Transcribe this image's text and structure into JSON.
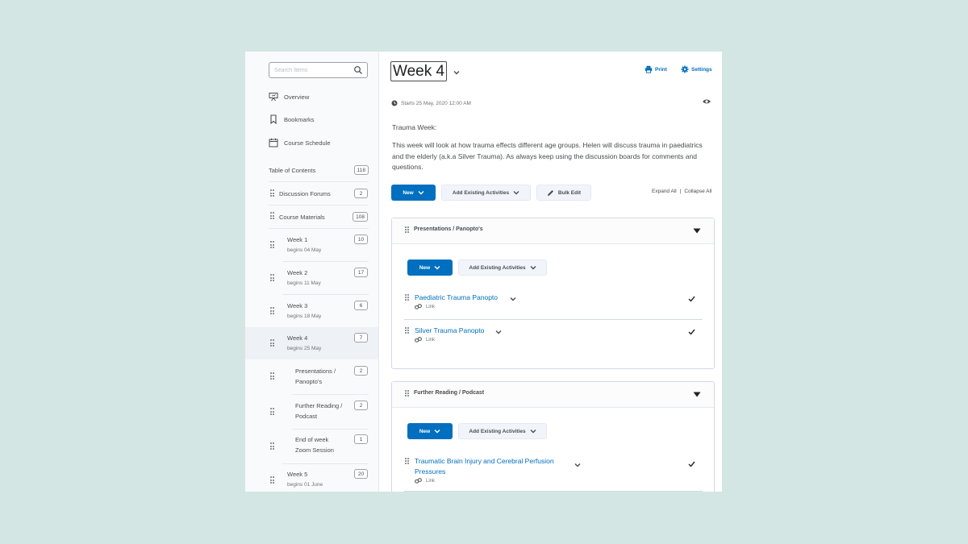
{
  "sidebar": {
    "search_placeholder": "Search Items",
    "links": [
      {
        "label": "Overview",
        "icon": "presentation-icon"
      },
      {
        "label": "Bookmarks",
        "icon": "bookmark-icon"
      },
      {
        "label": "Course Schedule",
        "icon": "calendar-icon"
      }
    ],
    "toc": {
      "label": "Table of Contents",
      "count": "118"
    },
    "items": [
      {
        "title": "Discussion Forums",
        "count": "2"
      },
      {
        "title": "Course Materials",
        "count": "108"
      },
      {
        "title": "Week 1",
        "sub": "begins 04 May",
        "count": "10"
      },
      {
        "title": "Week 2",
        "sub": "begins 11 May",
        "count": "17"
      },
      {
        "title": "Week 3",
        "sub": "begins 18 May",
        "count": "6"
      },
      {
        "title": "Week 4",
        "sub": "begins 25 May",
        "count": "7"
      },
      {
        "title": "Presentations /",
        "sub": "Panopto's",
        "count": "2"
      },
      {
        "title": "Further Reading /",
        "sub": "Podcast",
        "count": "2"
      },
      {
        "title": "End of week",
        "sub": "Zoom Session",
        "count": "1"
      },
      {
        "title": "Week 5",
        "sub": "begins 01 June",
        "count": "20"
      }
    ]
  },
  "header": {
    "title": "Week 4",
    "print_label": "Print",
    "settings_label": "Settings",
    "starts": "Starts 25 May, 2020 12:00 AM"
  },
  "description": {
    "heading": "Trauma Week:",
    "body": "This week will look at how trauma effects different age groups. Helen will discuss trauma in paediatrics and the elderly (a.k.a Silver Trauma). As always keep using the discussion boards for comments and questions."
  },
  "toolbar": {
    "new_label": "New",
    "add_existing_label": "Add Existing Activities",
    "bulk_edit_label": "Bulk Edit",
    "expand_all": "Expand All",
    "separator": "|",
    "collapse_all": "Collapse All"
  },
  "modules": [
    {
      "title": "Presentations / Panopto's",
      "new_label": "New",
      "add_existing_label": "Add Existing Activities",
      "topics": [
        {
          "title": "Paediatric Trauma Panopto",
          "type": "Link"
        },
        {
          "title": "Silver Trauma Panopto",
          "type": "Link"
        }
      ]
    },
    {
      "title": "Further Reading / Podcast",
      "new_label": "New",
      "add_existing_label": "Add Existing Activities",
      "topics": [
        {
          "title_line1": "Traumatic Brain Injury and Cerebral Perfusion",
          "title_line2": "Pressures",
          "type": "Link"
        }
      ]
    }
  ],
  "colors": {
    "accent": "#006fbf",
    "background": "#d3e6e3",
    "text": "#494c4e"
  }
}
